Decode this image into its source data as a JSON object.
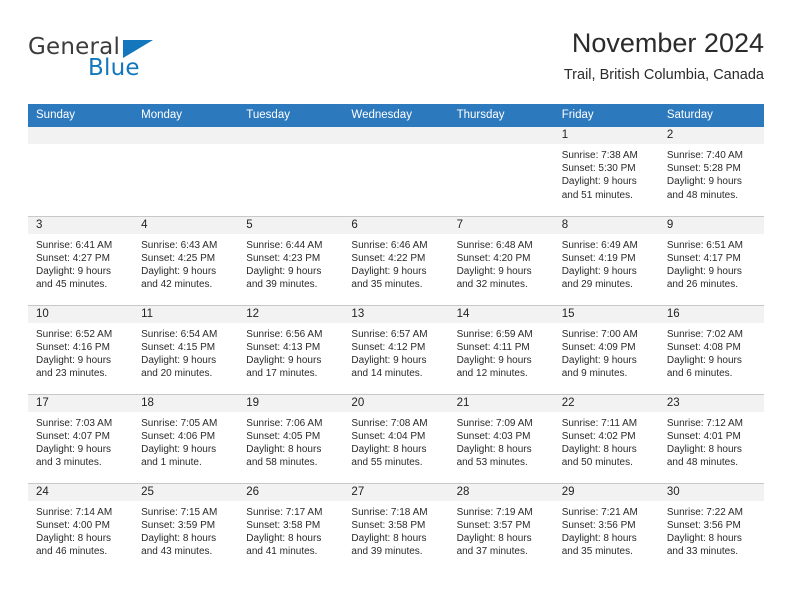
{
  "brand": {
    "name_part1": "General",
    "name_part2": "Blue",
    "accent_color": "#1277bc"
  },
  "header": {
    "title": "November 2024",
    "subtitle": "Trail, British Columbia, Canada"
  },
  "calendar": {
    "header_color": "#2d79bd",
    "daynum_bg": "#f2f2f2",
    "weekdays": [
      "Sunday",
      "Monday",
      "Tuesday",
      "Wednesday",
      "Thursday",
      "Friday",
      "Saturday"
    ],
    "weeks": [
      [
        {
          "day": "",
          "blank": true
        },
        {
          "day": "",
          "blank": true
        },
        {
          "day": "",
          "blank": true
        },
        {
          "day": "",
          "blank": true
        },
        {
          "day": "",
          "blank": true
        },
        {
          "day": "1",
          "sunrise": "Sunrise: 7:38 AM",
          "sunset": "Sunset: 5:30 PM",
          "daylight1": "Daylight: 9 hours",
          "daylight2": "and 51 minutes."
        },
        {
          "day": "2",
          "sunrise": "Sunrise: 7:40 AM",
          "sunset": "Sunset: 5:28 PM",
          "daylight1": "Daylight: 9 hours",
          "daylight2": "and 48 minutes."
        }
      ],
      [
        {
          "day": "3",
          "sunrise": "Sunrise: 6:41 AM",
          "sunset": "Sunset: 4:27 PM",
          "daylight1": "Daylight: 9 hours",
          "daylight2": "and 45 minutes."
        },
        {
          "day": "4",
          "sunrise": "Sunrise: 6:43 AM",
          "sunset": "Sunset: 4:25 PM",
          "daylight1": "Daylight: 9 hours",
          "daylight2": "and 42 minutes."
        },
        {
          "day": "5",
          "sunrise": "Sunrise: 6:44 AM",
          "sunset": "Sunset: 4:23 PM",
          "daylight1": "Daylight: 9 hours",
          "daylight2": "and 39 minutes."
        },
        {
          "day": "6",
          "sunrise": "Sunrise: 6:46 AM",
          "sunset": "Sunset: 4:22 PM",
          "daylight1": "Daylight: 9 hours",
          "daylight2": "and 35 minutes."
        },
        {
          "day": "7",
          "sunrise": "Sunrise: 6:48 AM",
          "sunset": "Sunset: 4:20 PM",
          "daylight1": "Daylight: 9 hours",
          "daylight2": "and 32 minutes."
        },
        {
          "day": "8",
          "sunrise": "Sunrise: 6:49 AM",
          "sunset": "Sunset: 4:19 PM",
          "daylight1": "Daylight: 9 hours",
          "daylight2": "and 29 minutes."
        },
        {
          "day": "9",
          "sunrise": "Sunrise: 6:51 AM",
          "sunset": "Sunset: 4:17 PM",
          "daylight1": "Daylight: 9 hours",
          "daylight2": "and 26 minutes."
        }
      ],
      [
        {
          "day": "10",
          "sunrise": "Sunrise: 6:52 AM",
          "sunset": "Sunset: 4:16 PM",
          "daylight1": "Daylight: 9 hours",
          "daylight2": "and 23 minutes."
        },
        {
          "day": "11",
          "sunrise": "Sunrise: 6:54 AM",
          "sunset": "Sunset: 4:15 PM",
          "daylight1": "Daylight: 9 hours",
          "daylight2": "and 20 minutes."
        },
        {
          "day": "12",
          "sunrise": "Sunrise: 6:56 AM",
          "sunset": "Sunset: 4:13 PM",
          "daylight1": "Daylight: 9 hours",
          "daylight2": "and 17 minutes."
        },
        {
          "day": "13",
          "sunrise": "Sunrise: 6:57 AM",
          "sunset": "Sunset: 4:12 PM",
          "daylight1": "Daylight: 9 hours",
          "daylight2": "and 14 minutes."
        },
        {
          "day": "14",
          "sunrise": "Sunrise: 6:59 AM",
          "sunset": "Sunset: 4:11 PM",
          "daylight1": "Daylight: 9 hours",
          "daylight2": "and 12 minutes."
        },
        {
          "day": "15",
          "sunrise": "Sunrise: 7:00 AM",
          "sunset": "Sunset: 4:09 PM",
          "daylight1": "Daylight: 9 hours",
          "daylight2": "and 9 minutes."
        },
        {
          "day": "16",
          "sunrise": "Sunrise: 7:02 AM",
          "sunset": "Sunset: 4:08 PM",
          "daylight1": "Daylight: 9 hours",
          "daylight2": "and 6 minutes."
        }
      ],
      [
        {
          "day": "17",
          "sunrise": "Sunrise: 7:03 AM",
          "sunset": "Sunset: 4:07 PM",
          "daylight1": "Daylight: 9 hours",
          "daylight2": "and 3 minutes."
        },
        {
          "day": "18",
          "sunrise": "Sunrise: 7:05 AM",
          "sunset": "Sunset: 4:06 PM",
          "daylight1": "Daylight: 9 hours",
          "daylight2": "and 1 minute."
        },
        {
          "day": "19",
          "sunrise": "Sunrise: 7:06 AM",
          "sunset": "Sunset: 4:05 PM",
          "daylight1": "Daylight: 8 hours",
          "daylight2": "and 58 minutes."
        },
        {
          "day": "20",
          "sunrise": "Sunrise: 7:08 AM",
          "sunset": "Sunset: 4:04 PM",
          "daylight1": "Daylight: 8 hours",
          "daylight2": "and 55 minutes."
        },
        {
          "day": "21",
          "sunrise": "Sunrise: 7:09 AM",
          "sunset": "Sunset: 4:03 PM",
          "daylight1": "Daylight: 8 hours",
          "daylight2": "and 53 minutes."
        },
        {
          "day": "22",
          "sunrise": "Sunrise: 7:11 AM",
          "sunset": "Sunset: 4:02 PM",
          "daylight1": "Daylight: 8 hours",
          "daylight2": "and 50 minutes."
        },
        {
          "day": "23",
          "sunrise": "Sunrise: 7:12 AM",
          "sunset": "Sunset: 4:01 PM",
          "daylight1": "Daylight: 8 hours",
          "daylight2": "and 48 minutes."
        }
      ],
      [
        {
          "day": "24",
          "sunrise": "Sunrise: 7:14 AM",
          "sunset": "Sunset: 4:00 PM",
          "daylight1": "Daylight: 8 hours",
          "daylight2": "and 46 minutes."
        },
        {
          "day": "25",
          "sunrise": "Sunrise: 7:15 AM",
          "sunset": "Sunset: 3:59 PM",
          "daylight1": "Daylight: 8 hours",
          "daylight2": "and 43 minutes."
        },
        {
          "day": "26",
          "sunrise": "Sunrise: 7:17 AM",
          "sunset": "Sunset: 3:58 PM",
          "daylight1": "Daylight: 8 hours",
          "daylight2": "and 41 minutes."
        },
        {
          "day": "27",
          "sunrise": "Sunrise: 7:18 AM",
          "sunset": "Sunset: 3:58 PM",
          "daylight1": "Daylight: 8 hours",
          "daylight2": "and 39 minutes."
        },
        {
          "day": "28",
          "sunrise": "Sunrise: 7:19 AM",
          "sunset": "Sunset: 3:57 PM",
          "daylight1": "Daylight: 8 hours",
          "daylight2": "and 37 minutes."
        },
        {
          "day": "29",
          "sunrise": "Sunrise: 7:21 AM",
          "sunset": "Sunset: 3:56 PM",
          "daylight1": "Daylight: 8 hours",
          "daylight2": "and 35 minutes."
        },
        {
          "day": "30",
          "sunrise": "Sunrise: 7:22 AM",
          "sunset": "Sunset: 3:56 PM",
          "daylight1": "Daylight: 8 hours",
          "daylight2": "and 33 minutes."
        }
      ]
    ]
  }
}
